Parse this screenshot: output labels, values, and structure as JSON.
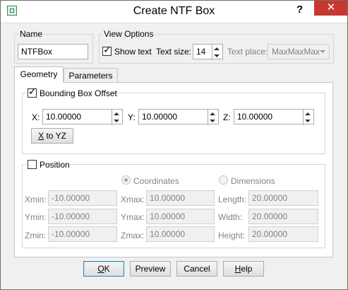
{
  "window": {
    "title": "Create NTF Box",
    "help_glyph": "?",
    "close_glyph": "✕"
  },
  "name_group": {
    "legend": "Name",
    "value": "NTFBox"
  },
  "view_options": {
    "legend": "View Options",
    "show_text_label": "Show text",
    "show_text_checked": true,
    "text_size_label": "Text size:",
    "text_size_value": "14",
    "text_place_label": "Text place:",
    "text_place_value": "MaxMaxMax"
  },
  "tabs": {
    "geometry": "Geometry",
    "parameters": "Parameters",
    "active": "geometry"
  },
  "bbox_offset": {
    "legend": "Bounding Box Offset",
    "checked": true,
    "x_label": "X:",
    "x_value": "10.00000",
    "y_label": "Y:",
    "y_value": "10.00000",
    "z_label": "Z:",
    "z_value": "10.00000",
    "x_to_yz_prefix": "X",
    "x_to_yz_rest": " to YZ"
  },
  "position": {
    "legend": "Position",
    "checked": false,
    "coordinates_label": "Coordinates",
    "dimensions_label": "Dimensions",
    "mode": "coordinates",
    "xmin_label": "Xmin:",
    "xmin_value": "-10.00000",
    "xmax_label": "Xmax:",
    "xmax_value": "10.00000",
    "length_label": "Length:",
    "length_value": "20.00000",
    "ymin_label": "Ymin:",
    "ymin_value": "-10.00000",
    "ymax_label": "Ymax:",
    "ymax_value": "10.00000",
    "width_label": "Width:",
    "width_value": "20.00000",
    "zmin_label": "Zmin:",
    "zmin_value": "-10.00000",
    "zmax_label": "Zmax:",
    "zmax_value": "10.00000",
    "height_label": "Height:",
    "height_value": "20.00000"
  },
  "buttons": {
    "ok_prefix": "O",
    "ok_rest": "K",
    "preview": "Preview",
    "cancel": "Cancel",
    "help_prefix": "H",
    "help_rest": "elp"
  },
  "colors": {
    "close_button": "#c9382f",
    "default_button_border": "#3c7fb1"
  }
}
